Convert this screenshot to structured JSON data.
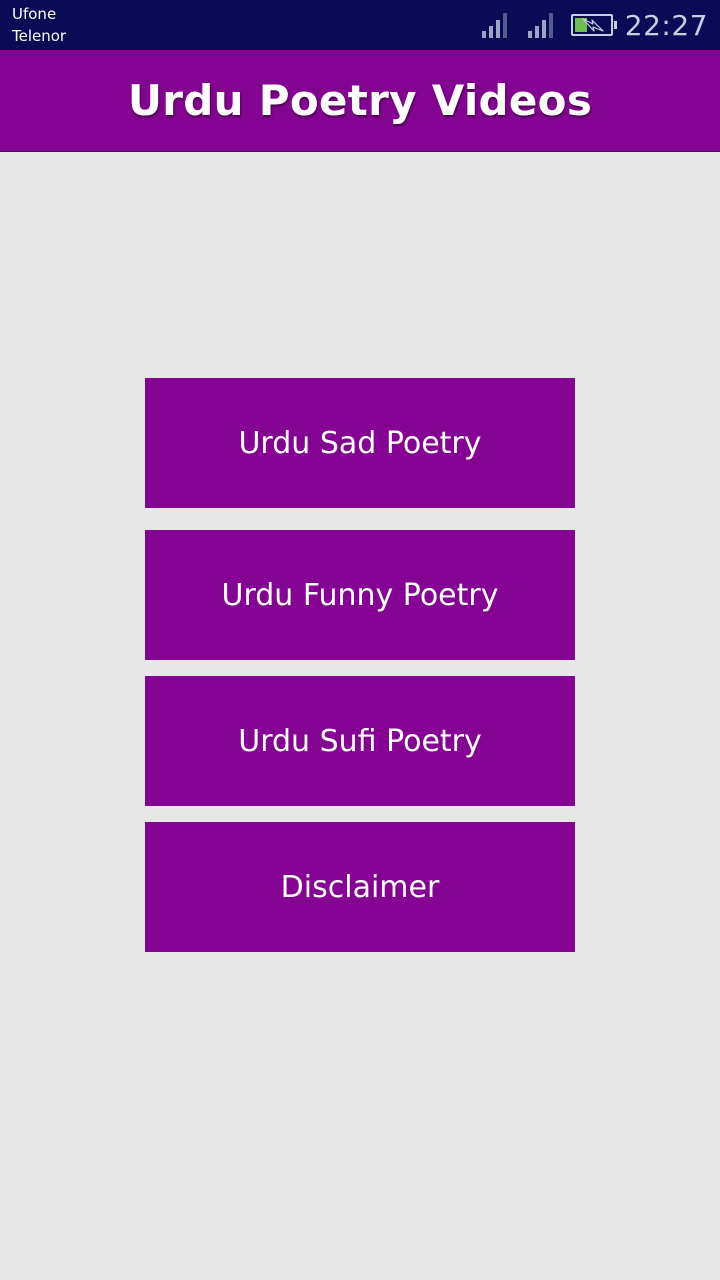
{
  "status_bar": {
    "carriers": [
      "Ufone",
      "Telenor"
    ],
    "time": "22:27",
    "battery_level": 0.35,
    "colors": {
      "background": "#0b0b55",
      "battery_fill": "#6dc04a"
    }
  },
  "app_bar": {
    "title": "Urdu Poetry Videos",
    "color": "#850392"
  },
  "menu": {
    "buttons": [
      {
        "label": "Urdu Sad Poetry"
      },
      {
        "label": "Urdu Funny Poetry"
      },
      {
        "label": "Urdu Sufi Poetry"
      },
      {
        "label": "Disclaimer"
      }
    ]
  }
}
